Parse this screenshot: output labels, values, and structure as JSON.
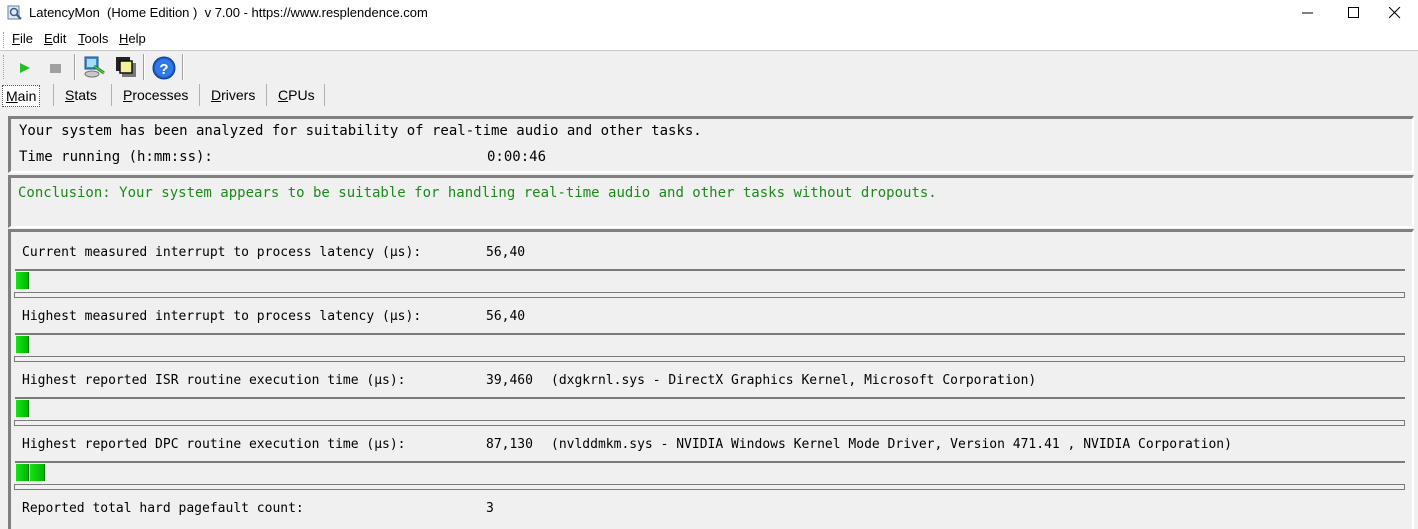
{
  "window": {
    "title": "LatencyMon  (Home Edition )  v 7.00 - https://www.resplendence.com",
    "controls": {
      "minimize": "minimize-icon",
      "maximize": "maximize-icon",
      "close": "close-icon"
    }
  },
  "menu": [
    {
      "label": "File",
      "accel": "F",
      "rest": "ile"
    },
    {
      "label": "Edit",
      "accel": "E",
      "rest": "dit"
    },
    {
      "label": "Tools",
      "accel": "T",
      "rest": "ools"
    },
    {
      "label": "Help",
      "accel": "H",
      "rest": "elp"
    }
  ],
  "toolbar": [
    {
      "name": "start-monitor",
      "icon": "play-icon",
      "color": "#22c022"
    },
    {
      "name": "stop-monitor",
      "icon": "stop-icon",
      "color": "#9a9a9a"
    },
    {
      "name": "analyze-computer",
      "icon": "computer-wrench-icon"
    },
    {
      "name": "windows-overlay",
      "icon": "windows-icon"
    },
    {
      "name": "help",
      "icon": "help-icon",
      "color": "#1d5fd0"
    }
  ],
  "tabs": [
    {
      "label": "Main",
      "accel": "M",
      "rest": "ain",
      "active": true
    },
    {
      "label": "Stats",
      "accel": "S",
      "rest": "tats",
      "active": false
    },
    {
      "label": "Processes",
      "accel": "P",
      "rest": "rocesses",
      "active": false
    },
    {
      "label": "Drivers",
      "accel": "D",
      "rest": "rivers",
      "active": false
    },
    {
      "label": "CPUs",
      "accel": "C",
      "rest": "PUs",
      "active": false
    }
  ],
  "summary": {
    "analyzed_text": "Your system has been analyzed for suitability of real-time audio and other tasks.",
    "time_running_label": "Time running (h:mm:ss):",
    "time_running_value": "0:00:46"
  },
  "conclusion": {
    "text": "Conclusion: Your system appears to be suitable for handling real-time audio and other tasks without dropouts.",
    "color": "#1a8a1a"
  },
  "metrics": [
    {
      "label": "Current measured interrupt to process latency (µs):",
      "value": "56,40",
      "detail": "",
      "bar_segments": 1
    },
    {
      "label": "Highest measured interrupt to process latency (µs):",
      "value": "56,40",
      "detail": "",
      "bar_segments": 1
    },
    {
      "label": "Highest reported ISR routine execution time (µs):",
      "value": "39,460",
      "detail": "(dxgkrnl.sys - DirectX Graphics Kernel, Microsoft Corporation)",
      "bar_segments": 1
    },
    {
      "label": "Highest reported DPC routine execution time (µs):",
      "value": "87,130",
      "detail": "(nvlddmkm.sys - NVIDIA Windows Kernel Mode Driver, Version 471.41 , NVIDIA Corporation)",
      "bar_segments": 2
    },
    {
      "label": "Reported total hard pagefault count:",
      "value": "3",
      "detail": ""
    }
  ],
  "colors": {
    "bar_green": "#00c800",
    "panel_bg": "#f0f0f0"
  }
}
